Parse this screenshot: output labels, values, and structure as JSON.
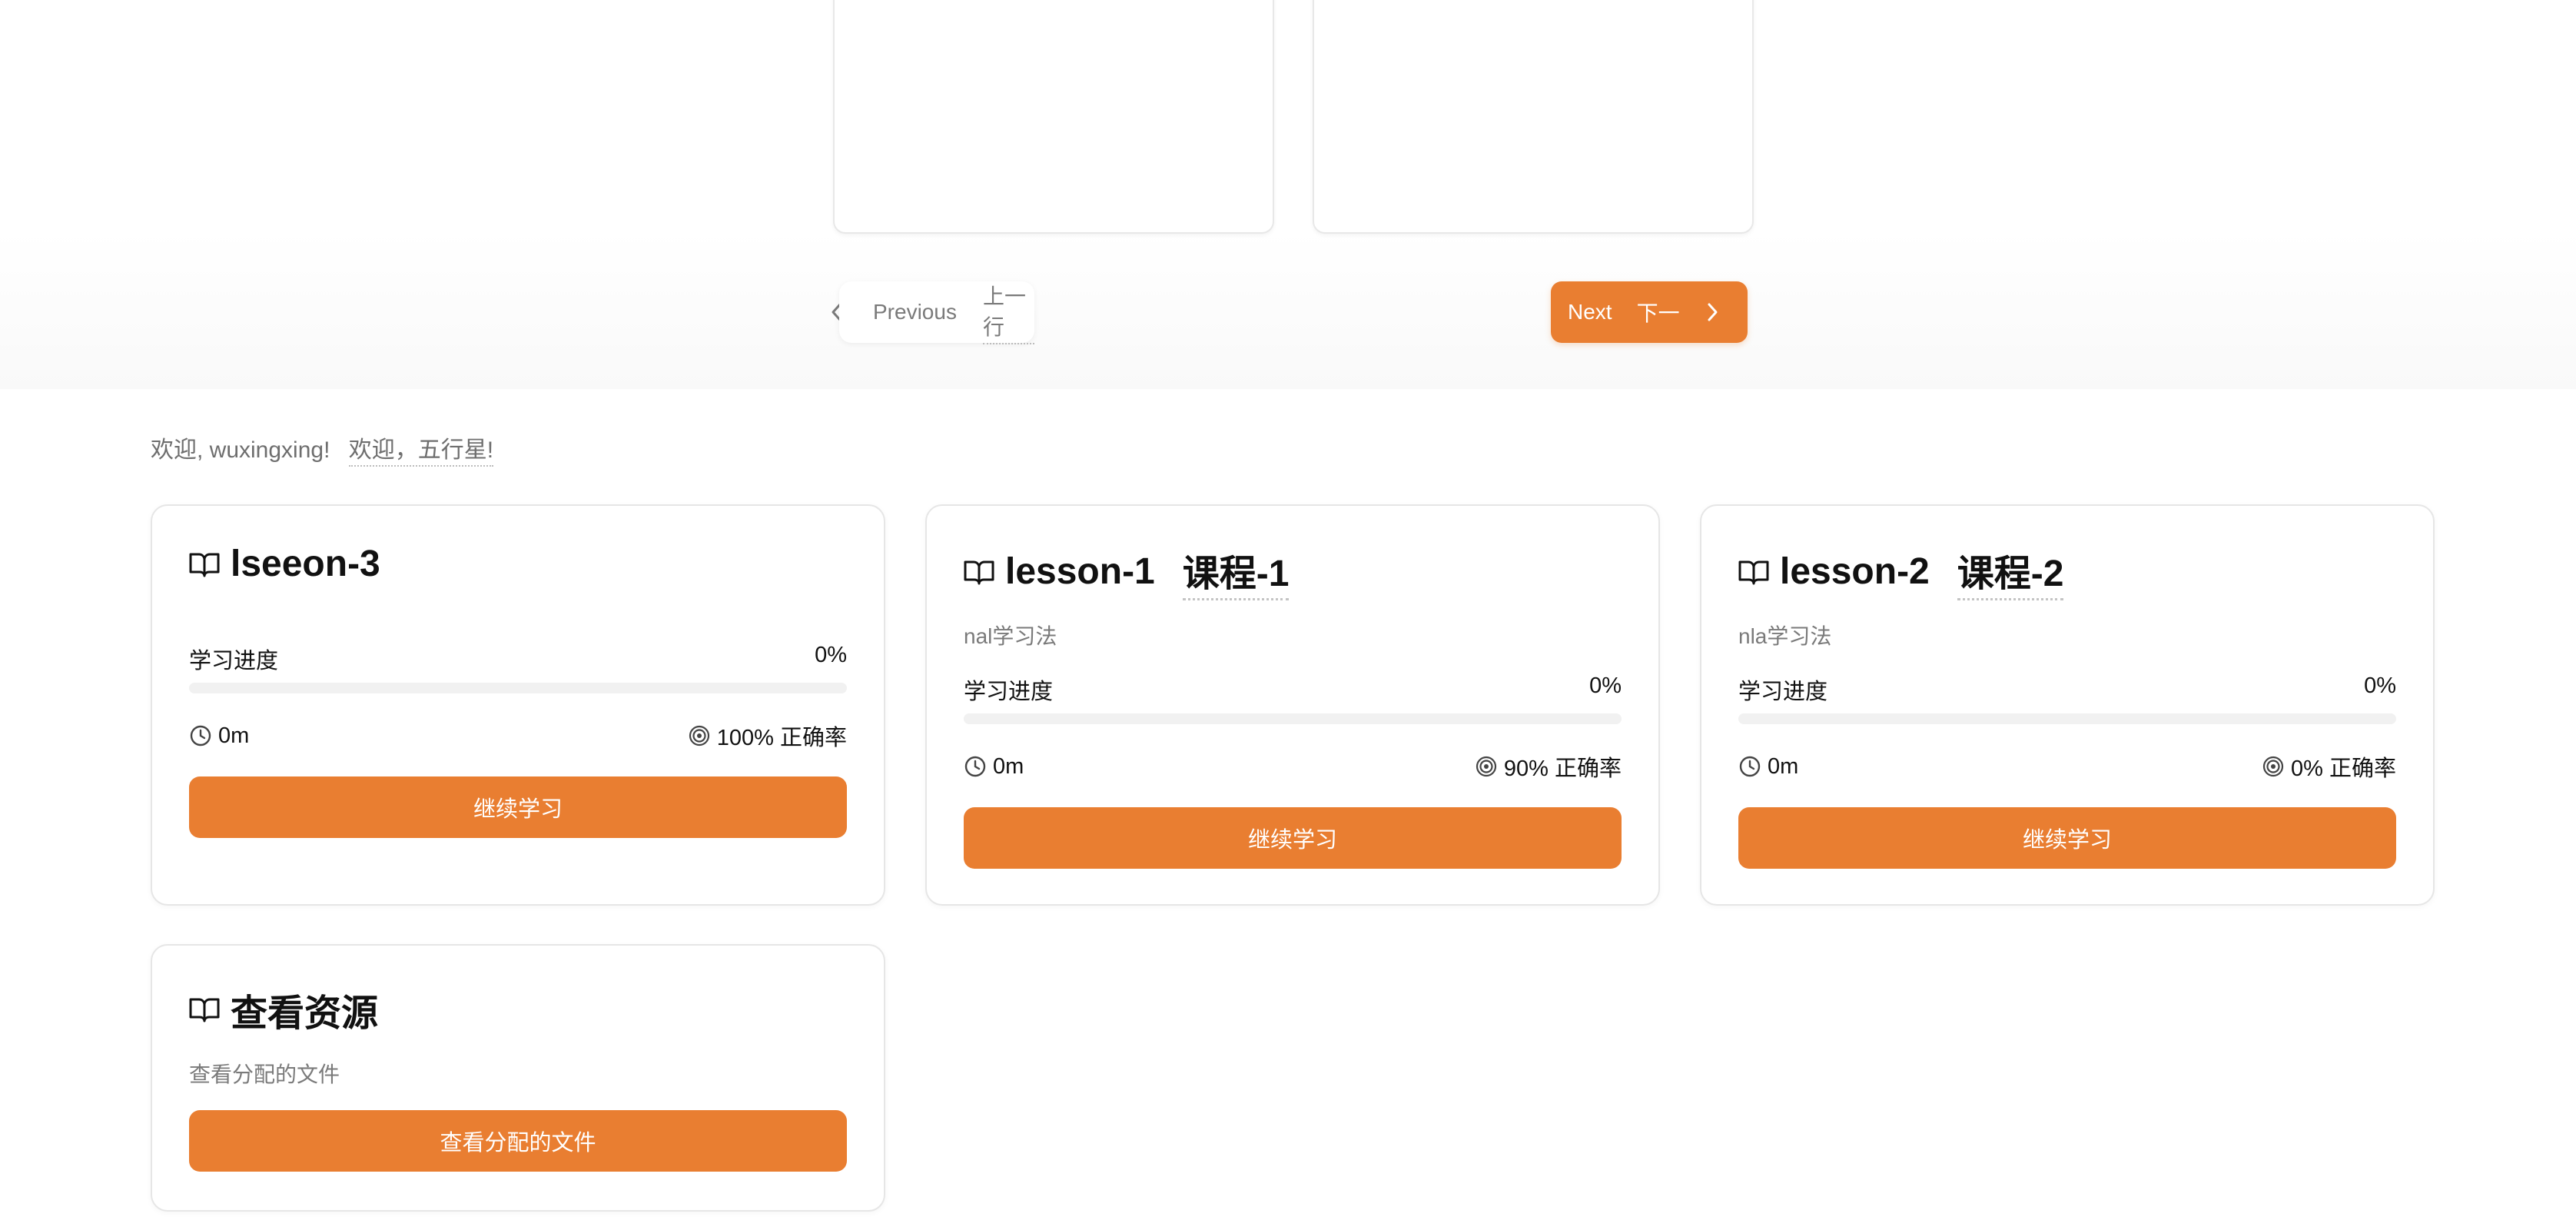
{
  "accent_color": "#e97e31",
  "carousel": {
    "prev_label": "Previous",
    "prev_label_cn": "上一行",
    "next_label": "Next",
    "next_label_cn": "下一"
  },
  "welcome": {
    "text": "欢迎, wuxingxing!",
    "text_cn": "欢迎，五行星!"
  },
  "progress_label": "学习进度",
  "continue_label": "继续学习",
  "lessons": [
    {
      "title": "lseeon-3",
      "title_cn": "",
      "subtitle": "",
      "progress_text": "0%",
      "progress": 0,
      "time": "0m",
      "accuracy": "100% 正确率"
    },
    {
      "title": "lesson-1",
      "title_cn": "课程-1",
      "subtitle": "nal学习法",
      "progress_text": "0%",
      "progress": 0,
      "time": "0m",
      "accuracy": "90% 正确率"
    },
    {
      "title": "lesson-2",
      "title_cn": "课程-2",
      "subtitle": "nla学习法",
      "progress_text": "0%",
      "progress": 0,
      "time": "0m",
      "accuracy": "0% 正确率"
    }
  ],
  "resources": {
    "title": "查看资源",
    "subtitle": "查看分配的文件",
    "button_label": "查看分配的文件"
  },
  "icons": {
    "title_icon": "book-open-icon",
    "time_icon": "clock-icon",
    "accuracy_icon": "target-icon",
    "prev_icon": "chevron-left-icon",
    "next_icon": "chevron-right-icon"
  }
}
